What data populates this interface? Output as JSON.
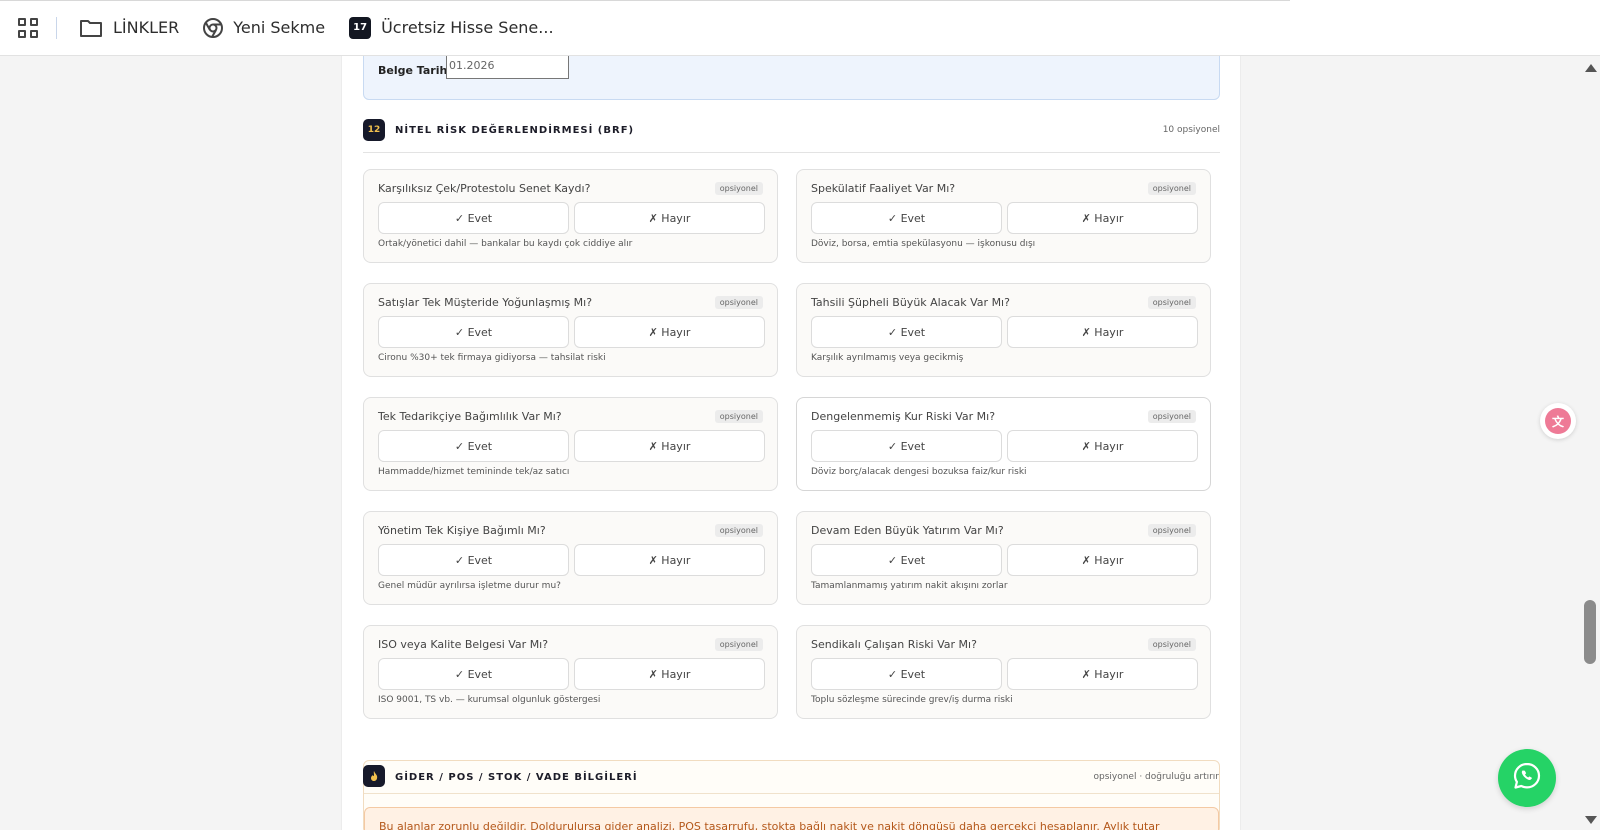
{
  "bookmarks": {
    "items": [
      {
        "label": "LİNKLER",
        "icon": "folder-icon"
      },
      {
        "label": "Yeni Sekme",
        "icon": "chrome-icon"
      },
      {
        "label": "Ücretsiz Hisse Sene...",
        "icon": "tradingview-icon",
        "badge": "17"
      }
    ]
  },
  "date_field": {
    "label": "Belge Tarihi",
    "value": "01.2026"
  },
  "section12": {
    "number": "12",
    "title": "NİTEL RİSK DEĞERLENDİRMESİ (BRF)",
    "optional_count": "10 opsiyonel"
  },
  "questions": [
    {
      "title": "Karşılıksız Çek/Protestolu Senet Kaydı?",
      "badge": "opsiyonel",
      "yes": "✓ Evet",
      "no": "✗ Hayır",
      "hint": "Ortak/yönetici dahil — bankalar bu kaydı çok ciddiye alır"
    },
    {
      "title": "Spekülatif Faaliyet Var Mı?",
      "badge": "opsiyonel",
      "yes": "✓ Evet",
      "no": "✗ Hayır",
      "hint": "Döviz, borsa, emtia spekülasyonu — işkonusu dışı"
    },
    {
      "title": "Satışlar Tek Müşteride Yoğunlaşmış Mı?",
      "badge": "opsiyonel",
      "yes": "✓ Evet",
      "no": "✗ Hayır",
      "hint": "Cironu %30+ tek firmaya gidiyorsa — tahsilat riski"
    },
    {
      "title": "Tahsili Şüpheli Büyük Alacak Var Mı?",
      "badge": "opsiyonel",
      "yes": "✓ Evet",
      "no": "✗ Hayır",
      "hint": "Karşılık ayrılmamış veya gecikmiş"
    },
    {
      "title": "Tek Tedarikçiye Bağımlılık Var Mı?",
      "badge": "opsiyonel",
      "yes": "✓ Evet",
      "no": "✗ Hayır",
      "hint": "Hammadde/hizmet temininde tek/az satıcı"
    },
    {
      "title": "Dengelenmemiş Kur Riski Var Mı?",
      "badge": "opsiyonel",
      "yes": "✓ Evet",
      "no": "✗ Hayır",
      "hint": "Döviz borç/alacak dengesi bozuksa faiz/kur riski"
    },
    {
      "title": "Yönetim Tek Kişiye Bağımlı Mı?",
      "badge": "opsiyonel",
      "yes": "✓ Evet",
      "no": "✗ Hayır",
      "hint": "Genel müdür ayrılırsa işletme durur mu?"
    },
    {
      "title": "Devam Eden Büyük Yatırım Var Mı?",
      "badge": "opsiyonel",
      "yes": "✓ Evet",
      "no": "✗ Hayır",
      "hint": "Tamamlanmamış yatırım nakit akışını zorlar"
    },
    {
      "title": "ISO veya Kalite Belgesi Var Mı?",
      "badge": "opsiyonel",
      "yes": "✓ Evet",
      "no": "✗ Hayır",
      "hint": "ISO 9001, TS vb. — kurumsal olgunluk göstergesi"
    },
    {
      "title": "Sendikalı Çalışan Riski Var Mı?",
      "badge": "opsiyonel",
      "yes": "✓ Evet",
      "no": "✗ Hayır",
      "hint": "Toplu sözleşme sürecinde grev/iş durma riski"
    }
  ],
  "section_expense": {
    "icon": "fire-icon",
    "title": "GİDER / POS / STOK / VADE BİLGİLERİ",
    "right": "opsiyonel · doğruluğu artırır",
    "note": "Bu alanlar zorunlu değildir. Doldurulursa gider analizi, POS tasarrufu, stokta bağlı nakit ve nakit döngüsü daha gerçekçi hesaplanır. Aylık tutar"
  },
  "colors": {
    "accent_dark": "#16192a",
    "badge_gold": "#f2c14e",
    "whatsapp": "#25d366",
    "translate": "#ee7a96",
    "note_text": "#b4581b"
  }
}
